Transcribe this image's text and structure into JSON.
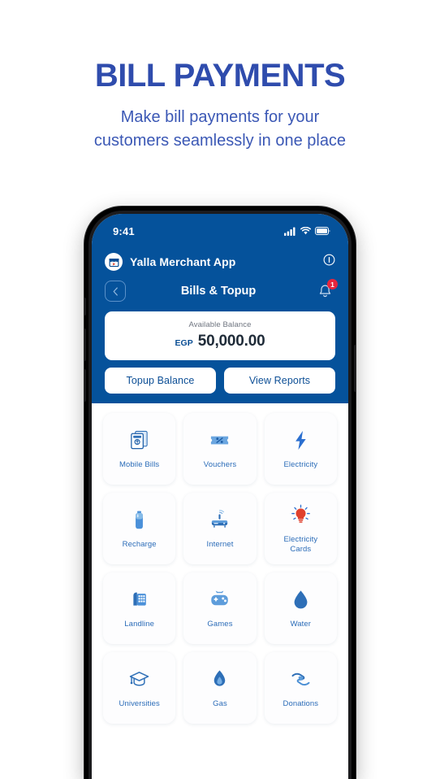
{
  "promo": {
    "title": "BILL PAYMENTS",
    "subtitle": "Make bill payments for your customers seamlessly in one place",
    "title_color": "#2f4cad",
    "subtitle_color": "#3b58b5"
  },
  "phone": {
    "statusbar": {
      "time": "9:41",
      "icons": [
        "signal-icon",
        "wifi-icon",
        "battery-icon"
      ]
    },
    "header": {
      "brand_name": "Yalla Merchant App",
      "brand_logo_icon": "store-icon",
      "info_icon": "info-icon",
      "background_color": "#05529b"
    },
    "titlebar": {
      "back_icon": "chevron-left-icon",
      "title": "Bills & Topup",
      "bell_icon": "bell-icon",
      "badge_count": "1",
      "badge_color": "#e8253c"
    },
    "balance": {
      "label": "Available Balance",
      "currency": "EGP",
      "amount": "50,000.00",
      "actions": [
        {
          "label": "Topup Balance",
          "name": "topup-balance-button"
        },
        {
          "label": "View Reports",
          "name": "view-reports-button"
        }
      ]
    },
    "services": [
      {
        "label": "Mobile Bills",
        "icon": "mobile-bills-icon"
      },
      {
        "label": "Vouchers",
        "icon": "vouchers-icon"
      },
      {
        "label": "Electricity",
        "icon": "electricity-bolt-icon"
      },
      {
        "label": "Recharge",
        "icon": "recharge-battery-icon"
      },
      {
        "label": "Internet",
        "icon": "internet-router-icon"
      },
      {
        "label": "Electricity\nCards",
        "icon": "lightbulb-icon"
      },
      {
        "label": "Landline",
        "icon": "landline-phone-icon"
      },
      {
        "label": "Games",
        "icon": "game-controller-icon"
      },
      {
        "label": "Water",
        "icon": "water-drop-icon"
      },
      {
        "label": "Universities",
        "icon": "graduation-cap-icon"
      },
      {
        "label": "Gas",
        "icon": "gas-flame-icon"
      },
      {
        "label": "Donations",
        "icon": "donation-hands-icon"
      }
    ],
    "accent_color": "#2b6cb8"
  }
}
